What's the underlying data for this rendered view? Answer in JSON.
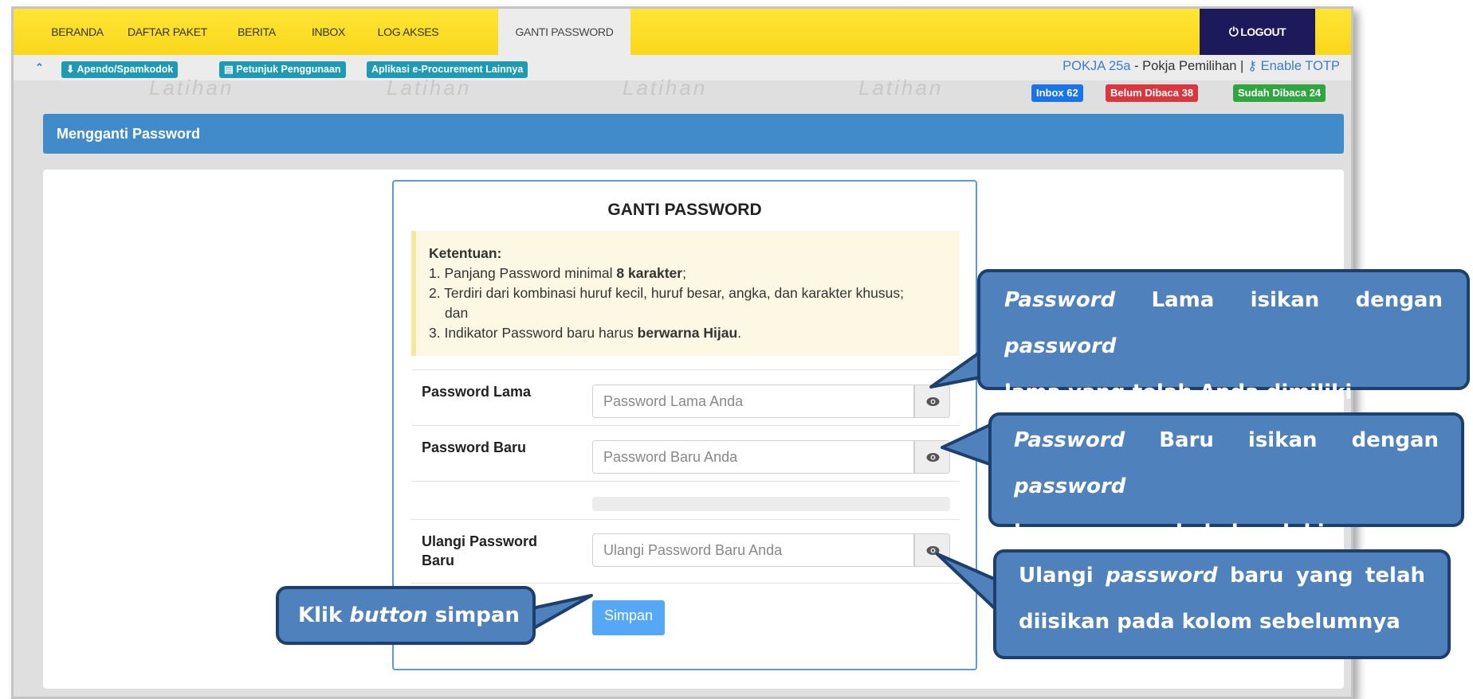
{
  "nav": {
    "items": [
      "BERANDA",
      "DAFTAR PAKET",
      "BERITA",
      "INBOX",
      "LOG AKSES",
      "GANTI PASSWORD"
    ],
    "active": "GANTI PASSWORD",
    "logout": "LOGOUT"
  },
  "toolbar": {
    "links": [
      "Apendo/Spamkodok",
      "Petunjuk Penggunaan",
      "Aplikasi e-Procurement Lainnya"
    ],
    "user_link": "POKJA 25a",
    "user_role": "- Pokja Pemilihan |",
    "totp": "Enable TOTP"
  },
  "badges": {
    "inbox": "Inbox 62",
    "unread": "Belum Dibaca 38",
    "read": "Sudah Dibaca 24"
  },
  "watermark": "Latihan",
  "panel": {
    "title": "Mengganti Password"
  },
  "form": {
    "title": "GANTI PASSWORD",
    "rules_head": "Ketentuan:",
    "rule1_pre": "1. Panjang Password minimal ",
    "rule1_bold": "8 karakter",
    "rule1_post": ";",
    "rule2_a": "2. Terdiri dari kombinasi huruf kecil, huruf besar, angka, dan karakter khusus;",
    "rule2_b": "dan",
    "rule3_pre": "3. Indikator Password baru harus ",
    "rule3_bold": "berwarna Hijau",
    "rule3_post": ".",
    "old_label": "Password Lama",
    "old_placeholder": "Password Lama Anda",
    "new_label": "Password Baru",
    "new_placeholder": "Password Baru Anda",
    "repeat_label_1": "Ulangi Password",
    "repeat_label_2": "Baru",
    "repeat_placeholder": "Ulangi Password Baru Anda",
    "submit": "Simpan"
  },
  "callouts": {
    "old": {
      "l1_i1": "Password",
      "l1_t1": " Lama isikan dengan ",
      "l1_i2": "password",
      "l2": "lama yang telah Anda dimiliki"
    },
    "new": {
      "l1_i1": "Password",
      "l1_t1": " Baru isikan dengan ",
      "l1_i2": "password",
      "l2": "baru yang anda kehendaki"
    },
    "repeat": {
      "l1_t0": "Ulangi ",
      "l1_i1": "password",
      "l1_t1": " baru yang telah",
      "l2": "diisikan pada kolom sebelumnya"
    },
    "button": {
      "t0": "Klik ",
      "i1": "button",
      "t1": " simpan"
    }
  },
  "colors": {
    "nav_yellow": "#f9d71c",
    "logout_navy": "#1c1a5a",
    "panel_blue": "#428bca",
    "callout_fill": "#4f81bd",
    "callout_border": "#1d3f6e",
    "badge_inbox": "#1a73e8",
    "badge_unread": "#d9363e",
    "badge_read": "#2fa640",
    "button_blue": "#54a8f5"
  }
}
